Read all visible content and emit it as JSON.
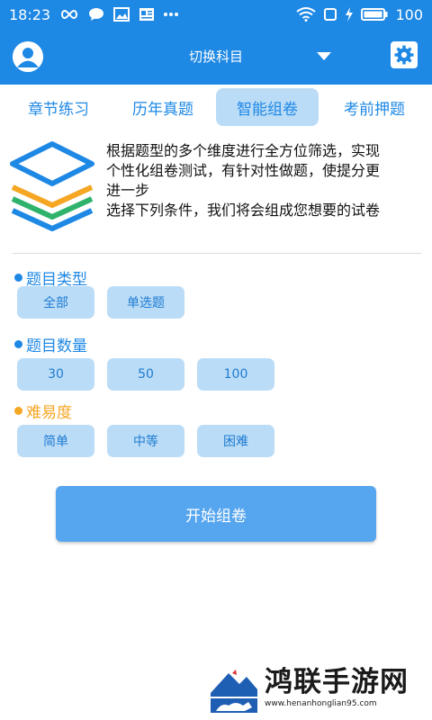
{
  "status_bar": {
    "time": "18:23",
    "battery": "100",
    "icons": [
      "infinity-icon",
      "chat-bubble-icon",
      "image-icon",
      "news-icon",
      "more-dots-icon",
      "wifi-icon",
      "square-icon",
      "charging-icon",
      "battery-icon"
    ]
  },
  "app_bar": {
    "title": "切换科目",
    "icons": [
      "avatar-icon",
      "chevron-down-icon",
      "gear-icon"
    ]
  },
  "tabs": [
    {
      "label": "章节练习",
      "active": false
    },
    {
      "label": "历年真题",
      "active": false
    },
    {
      "label": "智能组卷",
      "active": true
    },
    {
      "label": "考前押题",
      "active": false
    }
  ],
  "intro": {
    "line1": "根据题型的多个维度进行全方位筛选，实现",
    "line2": "个性化组卷测试，有针对性做题，使提分更",
    "line3": "进一步",
    "line4": "选择下列条件，我们将会组成您想要的试卷"
  },
  "sections": {
    "type": {
      "label": "题目类型",
      "options": [
        "全部",
        "单选题"
      ]
    },
    "count": {
      "label": "题目数量",
      "options": [
        "30",
        "50",
        "100"
      ]
    },
    "difficulty": {
      "label": "难易度",
      "options": [
        "简单",
        "中等",
        "困难"
      ]
    }
  },
  "start_button": "开始组卷",
  "watermark": {
    "title": "鸿联手游网",
    "url": "www.henanhonglian95.com"
  },
  "colors": {
    "primary": "#1e88e5",
    "tab_active_bg": "#bbdcf7",
    "option_bg": "#bbdcf7",
    "button": "#55a5ef",
    "section_blue": "#1e88e5",
    "section_orange": "#f5a623"
  }
}
